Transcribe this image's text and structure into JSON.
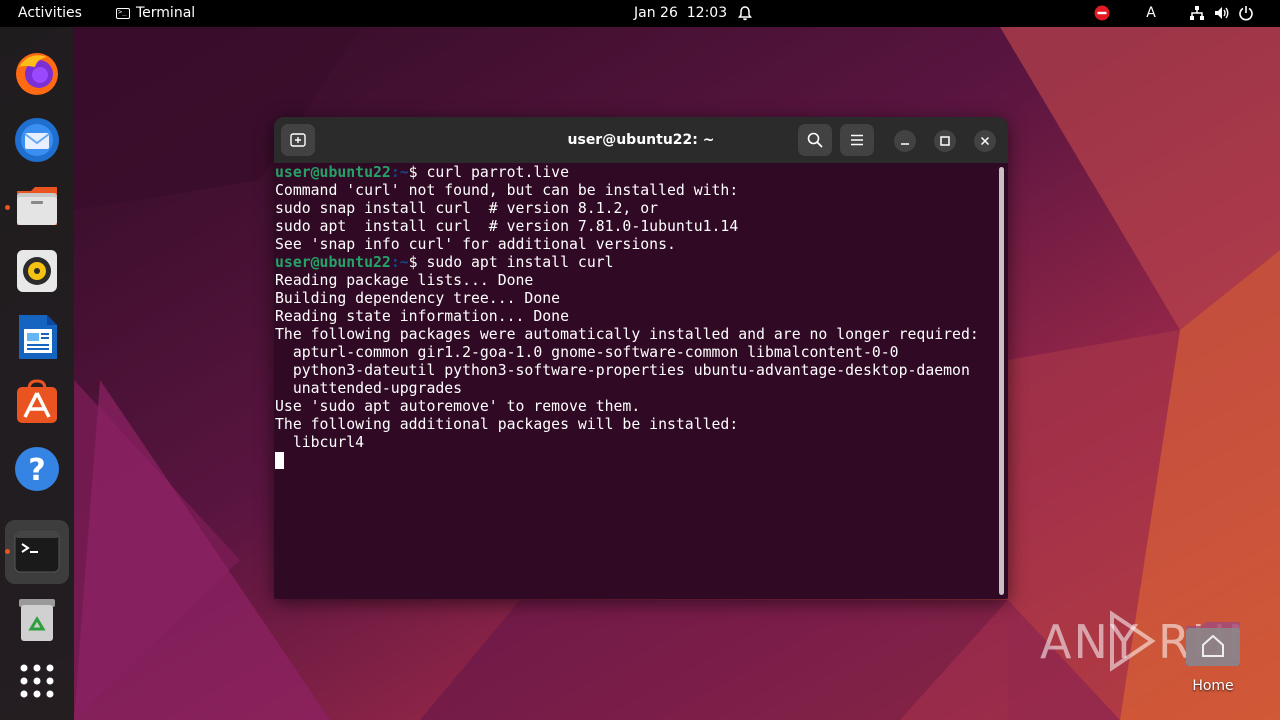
{
  "topbar": {
    "activities": "Activities",
    "app_name": "Terminal",
    "app_icon": "terminal-icon",
    "date": "Jan 26",
    "time": "12:03",
    "tray": {
      "keyboard_layout": "A",
      "icons": [
        "do-not-disturb-icon",
        "keyboard-layout-indicator",
        "network-icon",
        "volume-icon",
        "power-icon"
      ]
    }
  },
  "dock": {
    "items": [
      {
        "name": "firefox",
        "icon": "firefox-icon",
        "running": false
      },
      {
        "name": "thunderbird",
        "icon": "thunderbird-icon",
        "running": false
      },
      {
        "name": "files",
        "icon": "files-icon",
        "running": true
      },
      {
        "name": "rhythmbox",
        "icon": "rhythmbox-icon",
        "running": false
      },
      {
        "name": "libreoffice-writer",
        "icon": "writer-icon",
        "running": false
      },
      {
        "name": "ubuntu-software",
        "icon": "software-icon",
        "running": false
      },
      {
        "name": "help",
        "icon": "help-icon",
        "running": false
      },
      {
        "name": "terminal",
        "icon": "terminal-icon",
        "running": true,
        "active": true
      },
      {
        "name": "trash",
        "icon": "trash-icon",
        "running": false
      },
      {
        "name": "show-apps",
        "icon": "app-grid-icon",
        "running": false
      }
    ]
  },
  "terminal": {
    "title": "user@ubuntu22: ~",
    "header_buttons": [
      "new-tab-icon",
      "search-icon",
      "hamburger-menu-icon",
      "minimize-icon",
      "maximize-icon",
      "close-icon"
    ],
    "prompt_user": "user@ubuntu22",
    "prompt_path": ":~",
    "prompt_symbol": "$ ",
    "lines": [
      {
        "type": "prompt",
        "command": "curl parrot.live"
      },
      {
        "type": "output",
        "text": "Command 'curl' not found, but can be installed with:"
      },
      {
        "type": "output",
        "text": "sudo snap install curl  # version 8.1.2, or"
      },
      {
        "type": "output",
        "text": "sudo apt  install curl  # version 7.81.0-1ubuntu1.14"
      },
      {
        "type": "output",
        "text": "See 'snap info curl' for additional versions."
      },
      {
        "type": "prompt",
        "command": "sudo apt install curl"
      },
      {
        "type": "output",
        "text": "Reading package lists... Done"
      },
      {
        "type": "output",
        "text": "Building dependency tree... Done"
      },
      {
        "type": "output",
        "text": "Reading state information... Done"
      },
      {
        "type": "output",
        "text": "The following packages were automatically installed and are no longer required:"
      },
      {
        "type": "output",
        "text": "  apturl-common gir1.2-goa-1.0 gnome-software-common libmalcontent-0-0"
      },
      {
        "type": "output",
        "text": "  python3-dateutil python3-software-properties ubuntu-advantage-desktop-daemon"
      },
      {
        "type": "output",
        "text": "  unattended-upgrades"
      },
      {
        "type": "output",
        "text": "Use 'sudo apt autoremove' to remove them."
      },
      {
        "type": "output",
        "text": "The following additional packages will be installed:"
      },
      {
        "type": "output",
        "text": "  libcurl4"
      },
      {
        "type": "cursor",
        "text": ""
      }
    ]
  },
  "desktop": {
    "home_label": "Home",
    "watermark": "ANY RUN"
  },
  "colors": {
    "terminal_bg": "#300a24",
    "prompt_user": "#26a269",
    "prompt_path": "#12488b",
    "accent": "#e95420",
    "header_bg": "#2b2b2b"
  }
}
